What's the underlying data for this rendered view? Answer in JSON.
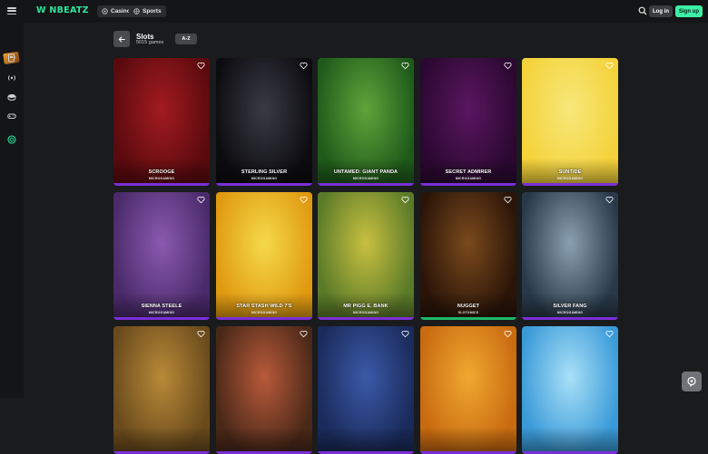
{
  "brand": {
    "logo_text": "W NBEATZ",
    "accent": "#3bf0a5"
  },
  "topnav": {
    "tabs": [
      {
        "label": "Casino",
        "icon": "casino-chip-icon"
      },
      {
        "label": "Sports",
        "icon": "sports-ball-icon"
      }
    ],
    "login_label": "Log in",
    "signup_label": "Sign up"
  },
  "sidebar": {
    "items": [
      {
        "name": "promotions-icon"
      },
      {
        "name": "slot-machine-icon"
      },
      {
        "name": "live-broadcast-icon"
      },
      {
        "name": "table-games-icon"
      },
      {
        "name": "gamepad-icon"
      },
      {
        "name": "support-coin-icon"
      }
    ]
  },
  "page": {
    "title": "Slots",
    "subtitle": "5015 games",
    "sort_label": "A-Z"
  },
  "games": [
    {
      "name": "SCROOGE",
      "provider": "MICROGAMING",
      "bg": [
        "#5a0a0e",
        "#a21b1f"
      ],
      "bar": "#7a2fd6"
    },
    {
      "name": "STERLING SILVER",
      "provider": "MICROGAMING",
      "bg": [
        "#0c0c10",
        "#3a3a44"
      ],
      "bar": "#7a2fd6"
    },
    {
      "name": "UNTAMED: GIANT PANDA",
      "provider": "MICROGAMING",
      "bg": [
        "#1f5a1a",
        "#5fa43a"
      ],
      "bar": "#7a2fd6"
    },
    {
      "name": "SECRET ADMIRER",
      "provider": "MICROGAMING",
      "bg": [
        "#2a0830",
        "#5a1660"
      ],
      "bar": "#7a2fd6"
    },
    {
      "name": "SUNTIDE",
      "provider": "MICROGAMING",
      "bg": [
        "#f4d23a",
        "#f7e87a"
      ],
      "bar": "#7a2fd6"
    },
    {
      "name": "SIENNA STEELE",
      "provider": "MICROGAMING",
      "bg": [
        "#4a2a6a",
        "#8a5ab0"
      ],
      "bar": "#7a2fd6"
    },
    {
      "name": "STAR STASH WILD 7'S",
      "provider": "MICROGAMING",
      "bg": [
        "#e09a10",
        "#f5d94a"
      ],
      "bar": "#7a2fd6"
    },
    {
      "name": "MR PIGG E. BANK",
      "provider": "MICROGAMING",
      "bg": [
        "#5a7a28",
        "#c8c040"
      ],
      "bar": "#7a2fd6"
    },
    {
      "name": "NUGGET",
      "provider": "SLOTOMICS",
      "bg": [
        "#2a1408",
        "#7a4a1c"
      ],
      "bar": "#1fb86a"
    },
    {
      "name": "SILVER FANG",
      "provider": "MICROGAMING",
      "bg": [
        "#283848",
        "#8aa0b0"
      ],
      "bar": "#7a2fd6"
    },
    {
      "name": "",
      "provider": "",
      "bg": [
        "#6a4a1c",
        "#b88a38"
      ],
      "bar": "#7a2fd6"
    },
    {
      "name": "",
      "provider": "",
      "bg": [
        "#4a2818",
        "#b85a3a"
      ],
      "bar": "#7a2fd6"
    },
    {
      "name": "",
      "provider": "",
      "bg": [
        "#1a2a5a",
        "#3a5aa8"
      ],
      "bar": "#7a2fd6"
    },
    {
      "name": "",
      "provider": "",
      "bg": [
        "#c86a10",
        "#f0a830"
      ],
      "bar": "#7a2fd6"
    },
    {
      "name": "",
      "provider": "",
      "bg": [
        "#3a9ad8",
        "#a8e0f8"
      ],
      "bar": "#7a2fd6"
    }
  ]
}
